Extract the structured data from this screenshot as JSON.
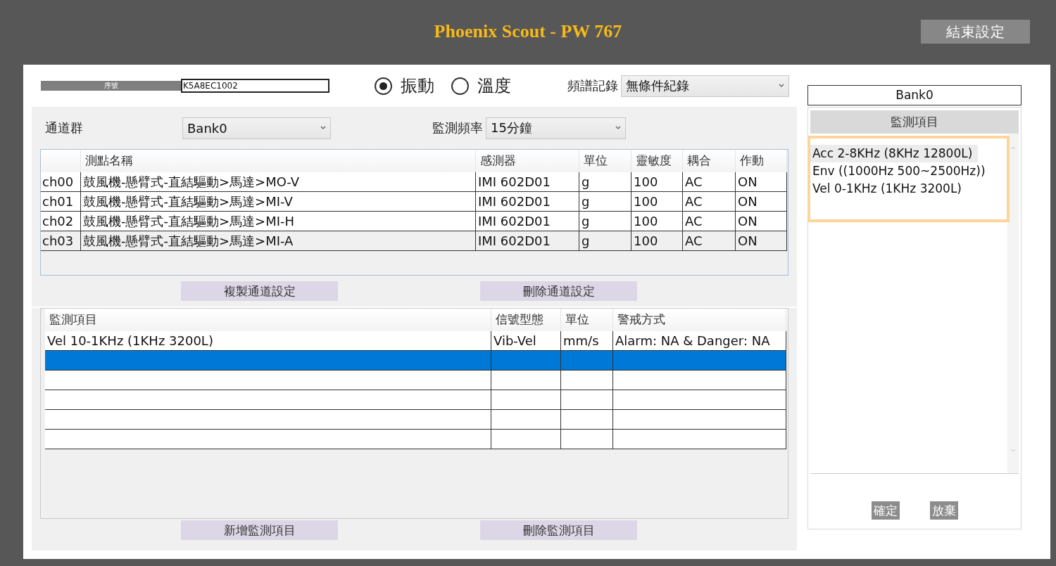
{
  "header": {
    "title": "Phoenix Scout - PW 767",
    "end_button": "結束設定"
  },
  "serial": {
    "label": "序號",
    "value": "K5A8EC1002"
  },
  "mode_options": [
    {
      "label": "振動",
      "selected": true
    },
    {
      "label": "溫度",
      "selected": false
    }
  ],
  "spectrum_record": {
    "label": "頻譜記錄",
    "value": "無條件紀錄"
  },
  "channel_group": {
    "label": "通道群",
    "value": "Bank0"
  },
  "monitor_frequency": {
    "label": "監測頻率",
    "value": "15分鐘"
  },
  "channel_table": {
    "columns": [
      "測點名稱",
      "感測器",
      "單位",
      "靈敏度",
      "耦合",
      "作動"
    ],
    "rows": [
      {
        "channel": "ch00",
        "cells": [
          "鼓風機-懸臂式-直結驅動>馬達>MO-V",
          "IMI 602D01",
          "g",
          "100",
          "AC",
          "ON"
        ],
        "selected": false
      },
      {
        "channel": "ch01",
        "cells": [
          "鼓風機-懸臂式-直結驅動>馬達>MI-V",
          "IMI 602D01",
          "g",
          "100",
          "AC",
          "ON"
        ],
        "selected": false
      },
      {
        "channel": "ch02",
        "cells": [
          "鼓風機-懸臂式-直結驅動>馬達>MI-H",
          "IMI 602D01",
          "g",
          "100",
          "AC",
          "ON"
        ],
        "selected": false
      },
      {
        "channel": "ch03",
        "cells": [
          "鼓風機-懸臂式-直結驅動>馬達>MI-A",
          "IMI 602D01",
          "g",
          "100",
          "AC",
          "ON"
        ],
        "selected": true
      }
    ]
  },
  "channel_buttons": [
    "複製通道設定",
    "刪除通道設定"
  ],
  "item_table": {
    "columns": [
      "監測項目",
      "信號型態",
      "單位",
      "警戒方式"
    ],
    "rows": [
      {
        "cells": [
          "Vel 10-1KHz (1KHz 3200L)",
          "Vib-Vel",
          "mm/s",
          "Alarm: NA & Danger: NA"
        ],
        "selected": false
      },
      {
        "selected": true
      },
      {
        "selected": false
      },
      {
        "selected": false
      },
      {
        "selected": false
      },
      {
        "selected": false
      }
    ]
  },
  "item_buttons": [
    "新增監測項目",
    "刪除監測項目"
  ],
  "side_panel": {
    "bank": "Bank0",
    "list_header": "監測項目",
    "items": [
      {
        "label": "Acc 2-8KHz (8KHz 12800L)",
        "selected": true
      },
      {
        "label": "Env ((1000Hz 500~2500Hz))",
        "selected": false
      },
      {
        "label": "Vel 0-1KHz (1KHz 3200L)",
        "selected": false
      }
    ],
    "buttons": [
      "確定",
      "放棄"
    ]
  }
}
